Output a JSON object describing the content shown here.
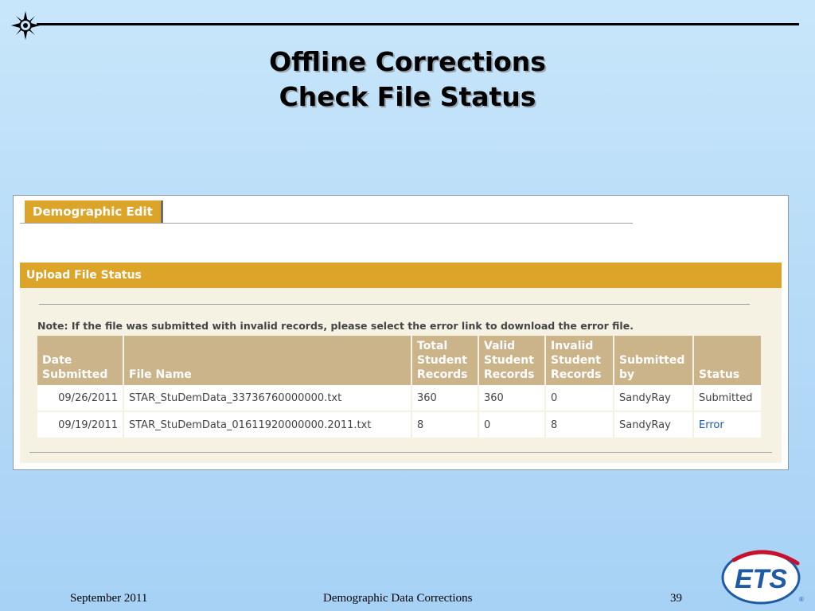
{
  "slide": {
    "title_line1": "Offline Corrections",
    "title_line2": "Check File Status",
    "logo_top_left": "star-compass-icon",
    "logo_bottom_right": "ets-logo",
    "ets_text": "ETS"
  },
  "app": {
    "tab_label": "Demographic Edit",
    "section_title": "Upload File Status",
    "note": "Note: If the file was submitted with invalid records, please select the error link to download the error file.",
    "table": {
      "headers": [
        [
          "Date",
          "Submitted"
        ],
        [
          "File Name"
        ],
        [
          "Total",
          "Student",
          "Records"
        ],
        [
          "Valid",
          "Student",
          "Records"
        ],
        [
          "Invalid",
          "Student",
          "Records"
        ],
        [
          "Submitted",
          "by"
        ],
        [
          "Status"
        ]
      ],
      "rows": [
        {
          "date": "09/26/2011",
          "file": "STAR_StuDemData_33736760000000.txt",
          "total": "360",
          "valid": "360",
          "invalid": "0",
          "by": "SandyRay",
          "status": "Submitted"
        },
        {
          "date": "09/19/2011",
          "file": "STAR_StuDemData_01611920000000.2011.txt",
          "total": "8",
          "valid": "0",
          "invalid": "8",
          "by": "SandyRay",
          "status": "Error"
        }
      ]
    }
  },
  "footer": {
    "date": "September 2011",
    "center": "Demographic Data Corrections",
    "page": "39"
  },
  "colors": {
    "accent_gold": "#dca52a",
    "header_tan": "#cbb38a",
    "link_blue": "#1a57b0",
    "ets_blue": "#1f5aa6",
    "ets_red": "#c8102e"
  }
}
